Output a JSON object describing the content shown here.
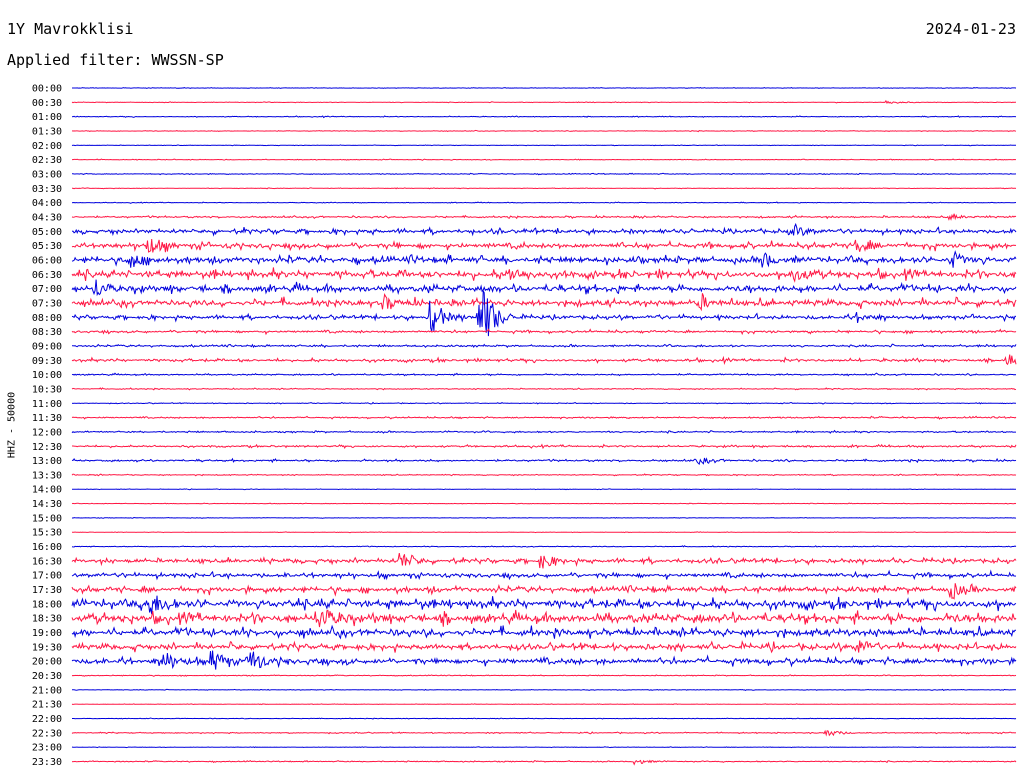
{
  "header": {
    "station": "1Y Mavrokklisi",
    "date": "2024-01-23",
    "filter": "Applied filter: WWSSN-SP",
    "channel_label": "HHZ - 50000"
  },
  "colors": {
    "even_row": "#0000dd",
    "odd_row": "#ff1744"
  },
  "chart_data": {
    "type": "line",
    "title": "1Y Mavrokklisi",
    "subtitle": "Applied filter: WWSSN-SP",
    "ylabel": "HHZ - 50000",
    "xlabel": "",
    "row_labels": [
      "00:00",
      "00:30",
      "01:00",
      "01:30",
      "02:00",
      "02:30",
      "03:00",
      "03:30",
      "04:00",
      "04:30",
      "05:00",
      "05:30",
      "06:00",
      "06:30",
      "07:00",
      "07:30",
      "08:00",
      "08:30",
      "09:00",
      "09:30",
      "10:00",
      "10:30",
      "11:00",
      "11:30",
      "12:00",
      "12:30",
      "13:00",
      "13:30",
      "14:00",
      "14:30",
      "15:00",
      "15:30",
      "16:00",
      "16:30",
      "17:00",
      "17:30",
      "18:00",
      "18:30",
      "19:00",
      "19:30",
      "20:00",
      "20:30",
      "21:00",
      "21:30",
      "22:00",
      "22:30",
      "23:00",
      "23:30"
    ],
    "minutes_per_row": 30,
    "row_activity": [
      0.05,
      0.06,
      0.08,
      0.06,
      0.05,
      0.07,
      0.08,
      0.06,
      0.07,
      0.18,
      0.45,
      0.55,
      0.65,
      0.75,
      0.7,
      0.65,
      0.4,
      0.25,
      0.2,
      0.3,
      0.15,
      0.1,
      0.08,
      0.15,
      0.15,
      0.2,
      0.2,
      0.1,
      0.05,
      0.05,
      0.05,
      0.05,
      0.08,
      0.45,
      0.45,
      0.55,
      0.9,
      0.95,
      0.75,
      0.6,
      0.6,
      0.08,
      0.06,
      0.05,
      0.05,
      0.1,
      0.05,
      0.1
    ],
    "events": [
      {
        "row": 1,
        "minute": 26,
        "amplitude": 0.25
      },
      {
        "row": 9,
        "minute": 28,
        "amplitude": 0.35
      },
      {
        "row": 10,
        "minute": 23,
        "amplitude": 0.8
      },
      {
        "row": 11,
        "minute": 2.5,
        "amplitude": 1.2
      },
      {
        "row": 11,
        "minute": 25,
        "amplitude": 0.9
      },
      {
        "row": 12,
        "minute": 2,
        "amplitude": 1.0
      },
      {
        "row": 12,
        "minute": 22,
        "amplitude": 1.0
      },
      {
        "row": 12,
        "minute": 28,
        "amplitude": 1.1
      },
      {
        "row": 13,
        "minute": 14,
        "amplitude": 0.9
      },
      {
        "row": 13,
        "minute": 23,
        "amplitude": 0.9
      },
      {
        "row": 14,
        "minute": 0.8,
        "amplitude": 1.1
      },
      {
        "row": 15,
        "minute": 10,
        "amplitude": 0.8
      },
      {
        "row": 15,
        "minute": 20,
        "amplitude": 0.8
      },
      {
        "row": 16,
        "minute": 11.5,
        "amplitude": 2.4
      },
      {
        "row": 16,
        "minute": 13,
        "amplitude": 2.6
      },
      {
        "row": 16,
        "minute": 13.2,
        "amplitude": 2.2
      },
      {
        "row": 16,
        "minute": 25,
        "amplitude": 0.6
      },
      {
        "row": 19,
        "minute": 29.8,
        "amplitude": 0.8
      },
      {
        "row": 26,
        "minute": 20,
        "amplitude": 0.5
      },
      {
        "row": 33,
        "minute": 10.5,
        "amplitude": 1.2
      },
      {
        "row": 33,
        "minute": 15,
        "amplitude": 1.0
      },
      {
        "row": 35,
        "minute": 28,
        "amplitude": 1.2
      },
      {
        "row": 36,
        "minute": 2.5,
        "amplitude": 1.8
      },
      {
        "row": 37,
        "minute": 8,
        "amplitude": 1.6
      },
      {
        "row": 39,
        "minute": 25,
        "amplitude": 1.0
      },
      {
        "row": 40,
        "minute": 3,
        "amplitude": 1.2
      },
      {
        "row": 40,
        "minute": 4.5,
        "amplitude": 1.5
      },
      {
        "row": 40,
        "minute": 5.8,
        "amplitude": 1.4
      },
      {
        "row": 45,
        "minute": 24,
        "amplitude": 0.6
      },
      {
        "row": 47,
        "minute": 18,
        "amplitude": 0.4
      }
    ]
  }
}
